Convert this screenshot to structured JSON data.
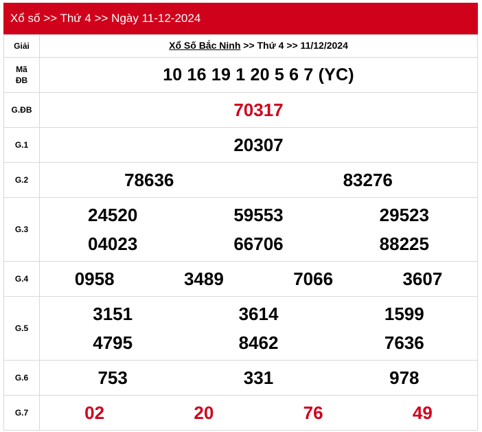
{
  "header": {
    "title": "Xổ số >> Thứ 4 >> Ngày 11-12-2024"
  },
  "title_row": {
    "label": "Giải",
    "link_text": "Xổ Số Bắc Ninh",
    "rest_text": " >> Thứ 4 >> 11/12/2024"
  },
  "ma_db": {
    "label_line1": "Mã",
    "label_line2": "ĐB",
    "value": "10 16 19 1 20 5 6 7 (YC)"
  },
  "prizes": {
    "gdb": {
      "label": "G.ĐB",
      "values": [
        "70317"
      ]
    },
    "g1": {
      "label": "G.1",
      "values": [
        "20307"
      ]
    },
    "g2": {
      "label": "G.2",
      "values": [
        "78636",
        "83276"
      ]
    },
    "g3": {
      "label": "G.3",
      "values": [
        "24520",
        "59553",
        "29523",
        "04023",
        "66706",
        "88225"
      ]
    },
    "g4": {
      "label": "G.4",
      "values": [
        "0958",
        "3489",
        "7066",
        "3607"
      ]
    },
    "g5": {
      "label": "G.5",
      "values": [
        "3151",
        "3614",
        "1599",
        "4795",
        "8462",
        "7636"
      ]
    },
    "g6": {
      "label": "G.6",
      "values": [
        "753",
        "331",
        "978"
      ]
    },
    "g7": {
      "label": "G.7",
      "values": [
        "02",
        "20",
        "76",
        "49"
      ]
    }
  },
  "colors": {
    "header_bg": "#d0021b",
    "highlight": "#d0021b",
    "border": "#d8d8d8"
  }
}
